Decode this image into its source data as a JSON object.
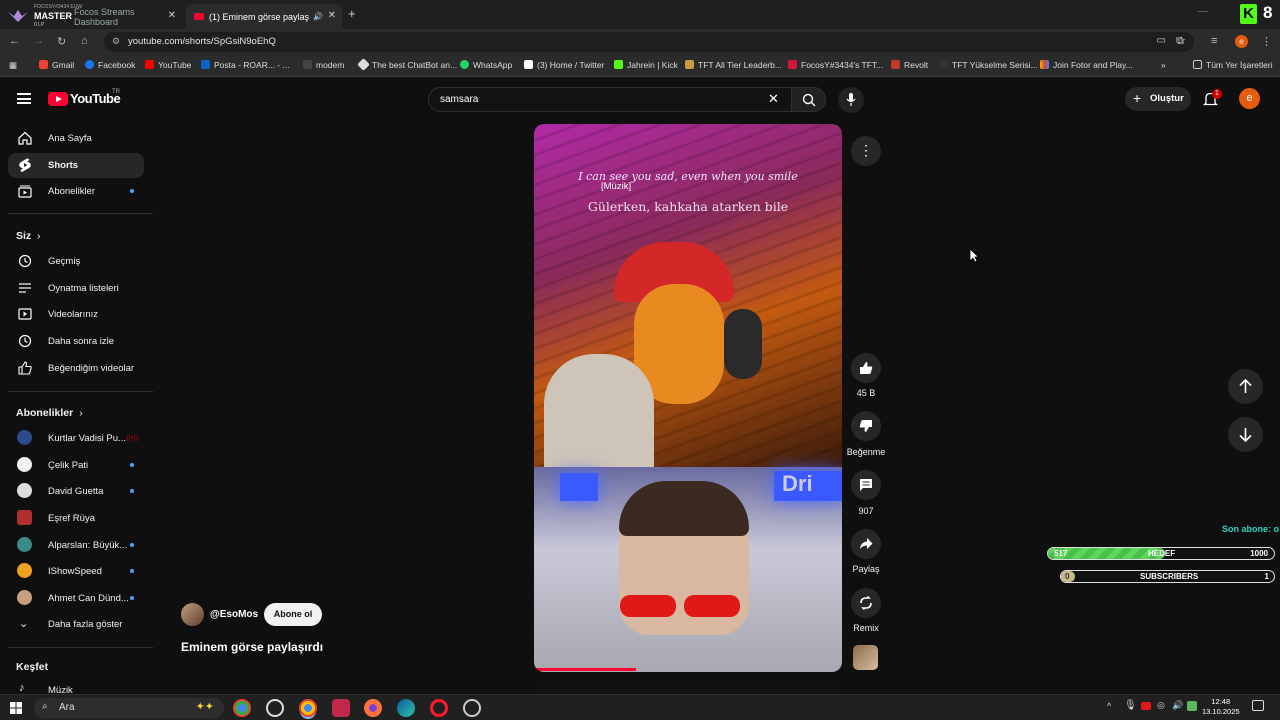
{
  "browser": {
    "tabs": [
      {
        "label": "Focos Streams Dashboard",
        "active": false
      },
      {
        "label": "(1) Eminem görse paylaşırdı",
        "active": true
      }
    ],
    "overlay": {
      "top": "FOCOSY#3434 EUW",
      "rank": "MASTER",
      "lp": "0 LP",
      "credit": "POWERED BY TRACKER.NETWORK"
    },
    "url": "youtube.com/shorts/SpGsiN9oEhQ",
    "bookmarks": [
      "Gmail",
      "Facebook",
      "YouTube",
      "Posta - ROAR... - ...",
      "modem",
      "The best ChatBot an...",
      "WhatsApp",
      "(3) Home / Twitter",
      "Jahrein | Kick",
      "TFT All Tier Leaderb...",
      "FocosY#3434's TFT...",
      "Revolt",
      "TFT Yükselme Serisi...",
      "Join Fotor and Play...",
      "Tüm Yer İşaretleri"
    ],
    "kick_count": "8",
    "avatar_letter": "e"
  },
  "youtube": {
    "logo_text": "YouTube",
    "logo_region": "TR",
    "search_value": "samsara",
    "create_label": "Oluştur",
    "notif_count": "1",
    "sidebar": {
      "main": [
        "Ana Sayfa",
        "Shorts",
        "Abonelikler"
      ],
      "you_header": "Siz",
      "you_items": [
        "Geçmiş",
        "Oynatma listeleri",
        "Videolarınız",
        "Daha sonra izle",
        "Beğendiğim videolar"
      ],
      "subs_header": "Abonelikler",
      "subs": [
        "Kurtlar Vadisi Pu...",
        "Çelik Pati",
        "David Guetta",
        "Eşref Rüya",
        "Alparslan: Büyük...",
        "IShowSpeed",
        "Ahmet Can Dünd..."
      ],
      "show_more": "Daha fazla göster",
      "explore_header": "Keşfet",
      "explore_items": [
        "Müzik"
      ]
    },
    "short": {
      "lyric_en": "I can see you sad, even when you smile",
      "lyric_tag": "[Müzik]",
      "lyric_tr": "Gülerken, kahkaha atarken bile",
      "channel": "@EsoMos",
      "subscribe": "Abone ol",
      "title": "Eminem görse paylaşırdı",
      "progress": 0.33
    },
    "actions": {
      "likes": "45 B",
      "dislike": "Beğenme",
      "comments": "907",
      "share": "Paylaş",
      "remix": "Remix"
    }
  },
  "stream_overlay": {
    "last_sub": "Son abone: o",
    "goal": {
      "current": "517",
      "label": "HEDEF",
      "target": "1000",
      "fraction": 0.517
    },
    "subs_bar": {
      "current": "0",
      "label": "SUBSCRIBERS",
      "target": "1",
      "fraction": 0.0
    }
  },
  "taskbar": {
    "search": "Ara",
    "time": "12:48",
    "date": "13.10.2025"
  },
  "colors": {
    "background": "#0f0f0f",
    "yt_red": "#ff0033",
    "blue_dot": "#3ea6ff",
    "goal_green": "#5cd65c",
    "overlay_cyan": "#29d3c0"
  }
}
